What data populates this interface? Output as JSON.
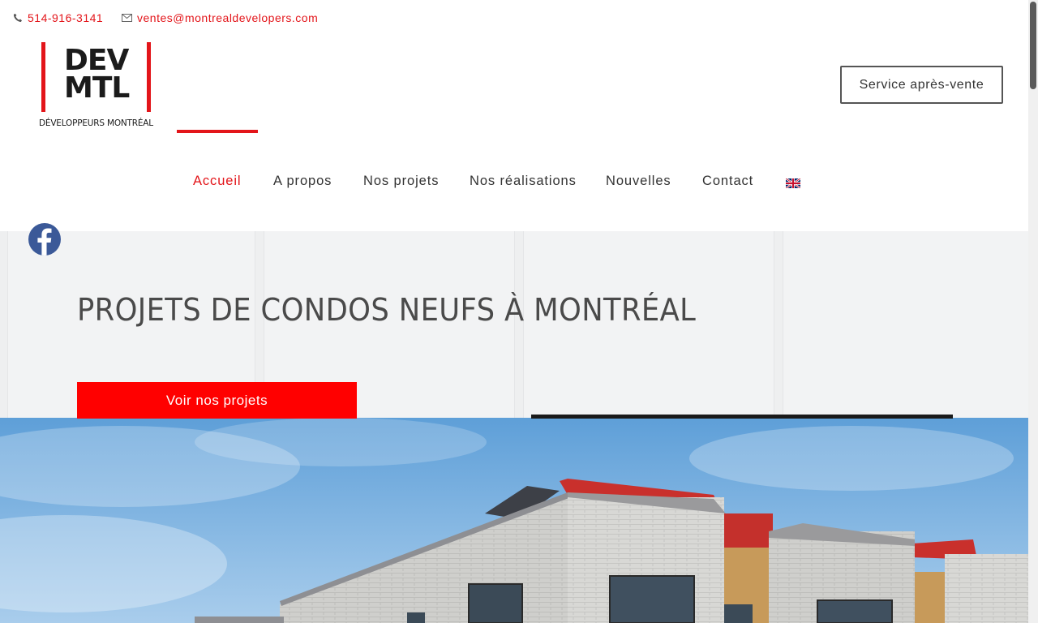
{
  "contact": {
    "phone": "514-916-3141",
    "email": "ventes@montrealdevelopers.com"
  },
  "logo": {
    "line1": "DEV",
    "line2": "MTL",
    "subtitle": "DÉVELOPPEURS MONTRÉAL"
  },
  "header": {
    "service_button": "Service après-vente"
  },
  "nav": {
    "items": [
      {
        "label": "Accueil",
        "active": true
      },
      {
        "label": "A propos"
      },
      {
        "label": "Nos projets"
      },
      {
        "label": "Nos réalisations"
      },
      {
        "label": "Nouvelles"
      },
      {
        "label": "Contact"
      }
    ],
    "language_icon": "uk-flag-icon"
  },
  "social": {
    "icon": "facebook-icon"
  },
  "hero": {
    "headline": "PROJETS DE CONDOS NEUFS À MONTRÉAL",
    "cta_label": "Voir nos projets"
  },
  "colors": {
    "accent": "#e3151a",
    "cta": "#ff0000",
    "facebook": "#3b5998"
  }
}
